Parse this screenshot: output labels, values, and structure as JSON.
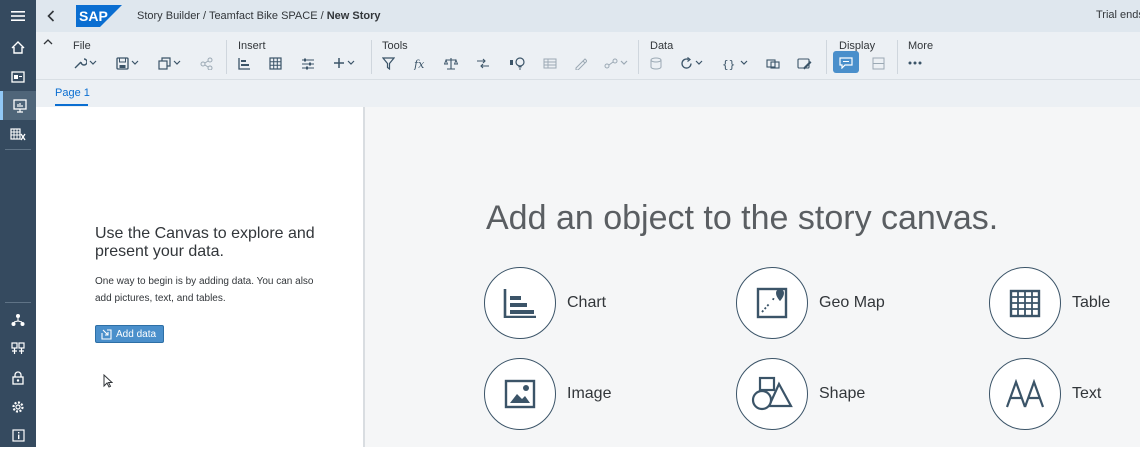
{
  "shell": {
    "logo_text": "SAP",
    "breadcrumb": {
      "path": "Story Builder / Teamfact Bike SPACE / ",
      "current": "New Story"
    },
    "trial_text": "Trial ends"
  },
  "rail": {
    "top_items": [
      "home-icon",
      "files-icon",
      "stories-icon",
      "modeler-icon"
    ],
    "bottom_items": [
      "connections-icon",
      "catalog-icon",
      "security-icon",
      "settings-icon",
      "info-icon"
    ]
  },
  "toolbar": {
    "groups": {
      "file": "File",
      "insert": "Insert",
      "tools": "Tools",
      "data": "Data",
      "display": "Display",
      "more": "More"
    }
  },
  "tabs": {
    "page1": "Page 1"
  },
  "left_panel": {
    "title": "Use the Canvas to explore and present your data.",
    "body": "One way to begin is by adding data. You can also add pictures, text, and tables.",
    "add_data_label": "Add data"
  },
  "canvas": {
    "title": "Add an object to the story canvas.",
    "objects": {
      "chart": "Chart",
      "geo_map": "Geo Map",
      "table": "Table",
      "image": "Image",
      "shape": "Shape",
      "text": "Text"
    }
  },
  "colors": {
    "rail": "#354a5f",
    "shell": "#dfe7ee",
    "toolbar": "#ecf0f4",
    "accent": "#0a6ed1",
    "button": "#4a8fcb",
    "icon": "#3b5468"
  }
}
